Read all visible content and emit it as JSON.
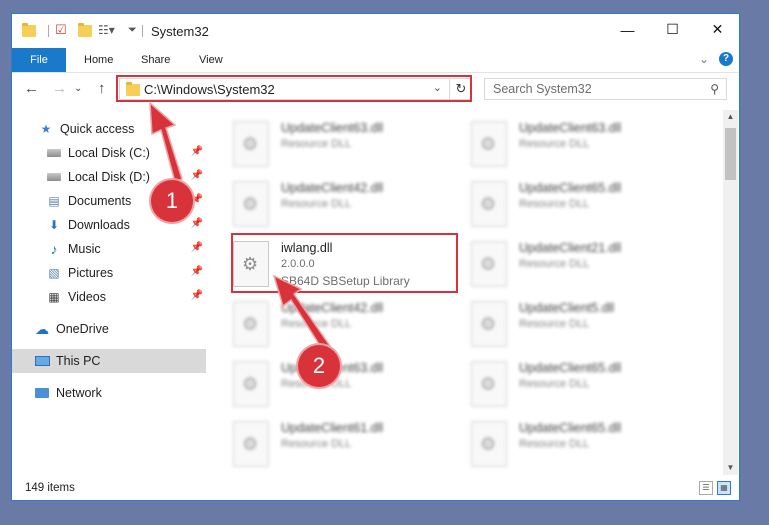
{
  "window": {
    "title": "System32",
    "controls": {
      "minimize": "—",
      "maximize": "☐",
      "close": "✕"
    }
  },
  "ribbon": {
    "tabs": [
      "File",
      "Home",
      "Share",
      "View"
    ],
    "expand_glyph": "⌄",
    "help_glyph": "?"
  },
  "nav": {
    "back_glyph": "←",
    "forward_glyph": "→",
    "recent_glyph": "⌄",
    "up_glyph": "↑",
    "address": "C:\\Windows\\System32",
    "address_dropdown_glyph": "⌄",
    "refresh_glyph": "↻",
    "search_placeholder": "Search System32",
    "search_glyph": "⚲"
  },
  "sidebar": {
    "items": [
      {
        "label": "Quick access",
        "icon": "star-icon",
        "glyph": "★",
        "color": "#3d7fd1"
      },
      {
        "label": "Local Disk (C:)",
        "icon": "disk-icon",
        "pinned": true
      },
      {
        "label": "Local Disk (D:)",
        "icon": "disk-icon",
        "pinned": true
      },
      {
        "label": "Documents",
        "icon": "documents-icon",
        "glyph": "▤",
        "pinned": true,
        "color": "#5c7fa8"
      },
      {
        "label": "Downloads",
        "icon": "download-icon",
        "glyph": "⬇",
        "pinned": true,
        "color": "#2f72c4"
      },
      {
        "label": "Music",
        "icon": "music-icon",
        "glyph": "♪",
        "pinned": true,
        "color": "#2f72c4"
      },
      {
        "label": "Pictures",
        "icon": "pictures-icon",
        "glyph": "▧",
        "pinned": true,
        "color": "#4f7fae"
      },
      {
        "label": "Videos",
        "icon": "videos-icon",
        "glyph": "▦",
        "pinned": true,
        "color": "#444"
      },
      {
        "label": "OneDrive",
        "icon": "cloud-icon",
        "glyph": "☁",
        "color": "#1e72c8"
      },
      {
        "label": "This PC",
        "icon": "computer-icon",
        "selected": true
      },
      {
        "label": "Network",
        "icon": "network-icon"
      }
    ],
    "pin_glyph": "📌"
  },
  "files": {
    "left_column": [
      {
        "name": "UpdateClient63.dll",
        "type": "Resource DLL"
      },
      {
        "name": "UpdateClient42.dll",
        "type": "Resource DLL"
      },
      {
        "name": "iwlang.dll",
        "type": "2.0.0.0",
        "description": "SB64D SBSetup Library",
        "highlighted": true
      },
      {
        "name": "UpdateClient42.dll",
        "type": "Resource DLL"
      },
      {
        "name": "UpdateClient63.dll",
        "type": "Resource DLL"
      },
      {
        "name": "UpdateClient61.dll",
        "type": "Resource DLL"
      }
    ],
    "right_column": [
      {
        "name": "UpdateClient63.dll",
        "type": "Resource DLL"
      },
      {
        "name": "UpdateClient65.dll",
        "type": "Resource DLL"
      },
      {
        "name": "UpdateClient21.dll",
        "type": "Resource DLL"
      },
      {
        "name": "UpdateClient5.dll",
        "type": "Resource DLL"
      },
      {
        "name": "UpdateClient65.dll",
        "type": "Resource DLL"
      },
      {
        "name": "UpdateClient65.dll",
        "type": "Resource DLL"
      }
    ]
  },
  "status": {
    "item_count": "149 items"
  },
  "annotations": {
    "step1": "1",
    "step2": "2",
    "color": "#d8333a"
  }
}
